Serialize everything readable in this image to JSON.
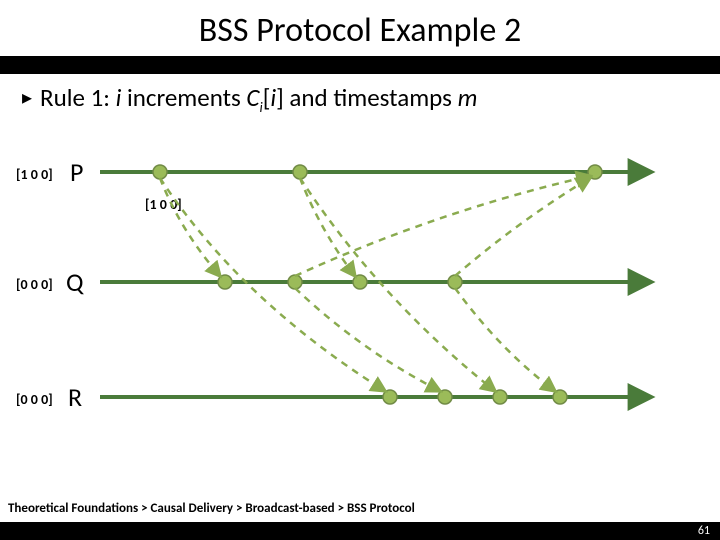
{
  "title": "BSS Protocol Example 2",
  "rule_prefix": "Rule 1: ",
  "rule_i": "i",
  "rule_mid": " increments ",
  "rule_C": "C",
  "rule_bracket": "[",
  "rule_i2": "i",
  "rule_close": "] and timestamps ",
  "rule_m": "m",
  "processes": {
    "P": {
      "label": "P",
      "vec": "[1 0 0]"
    },
    "Q": {
      "label": "Q",
      "vec": "[0 0 0]"
    },
    "R": {
      "label": "R",
      "vec": "[0 0 0]"
    }
  },
  "msg_label": "[1 0 0]",
  "breadcrumb": "Theoretical Foundations > Causal Delivery > Broadcast-based > BSS Protocol",
  "page": "61",
  "colors": {
    "timeline": "#4a7b3a",
    "node_fill": "#9bbb59",
    "node_stroke": "#718b46",
    "arrow_dash": "#8aab4f"
  }
}
